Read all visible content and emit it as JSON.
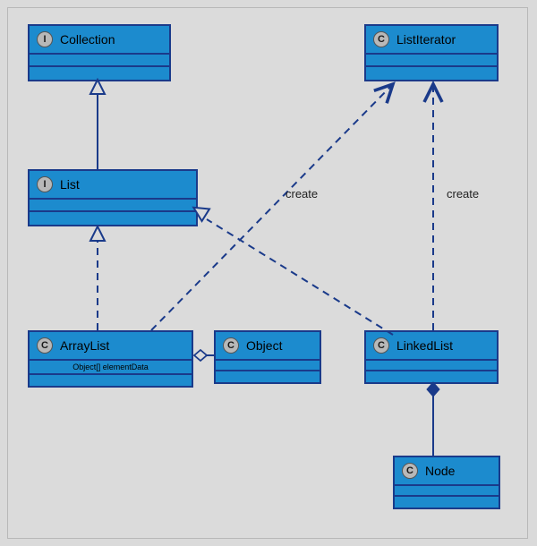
{
  "classes": {
    "collection": {
      "stereotype": "I",
      "name": "Collection"
    },
    "list": {
      "stereotype": "I",
      "name": "List"
    },
    "listIterator": {
      "stereotype": "C",
      "name": "ListIterator"
    },
    "arrayList": {
      "stereotype": "C",
      "name": "ArrayList",
      "attr": "Object[] elementData"
    },
    "object": {
      "stereotype": "C",
      "name": "Object"
    },
    "linkedList": {
      "stereotype": "C",
      "name": "LinkedList"
    },
    "node": {
      "stereotype": "C",
      "name": "Node"
    }
  },
  "labels": {
    "create1": "create",
    "create2": "create"
  },
  "chart_data": {
    "type": "uml_class_diagram",
    "nodes": [
      {
        "id": "Collection",
        "stereotype": "interface"
      },
      {
        "id": "List",
        "stereotype": "interface"
      },
      {
        "id": "ListIterator",
        "stereotype": "class"
      },
      {
        "id": "ArrayList",
        "stereotype": "class",
        "attributes": [
          "Object[] elementData"
        ]
      },
      {
        "id": "Object",
        "stereotype": "class"
      },
      {
        "id": "LinkedList",
        "stereotype": "class"
      },
      {
        "id": "Node",
        "stereotype": "class"
      }
    ],
    "edges": [
      {
        "from": "List",
        "to": "Collection",
        "type": "generalization"
      },
      {
        "from": "ArrayList",
        "to": "List",
        "type": "realization"
      },
      {
        "from": "LinkedList",
        "to": "List",
        "type": "realization"
      },
      {
        "from": "ArrayList",
        "to": "Object",
        "type": "aggregation"
      },
      {
        "from": "LinkedList",
        "to": "Node",
        "type": "composition"
      },
      {
        "from": "ArrayList",
        "to": "ListIterator",
        "type": "dependency",
        "label": "create"
      },
      {
        "from": "LinkedList",
        "to": "ListIterator",
        "type": "dependency",
        "label": "create"
      }
    ]
  }
}
